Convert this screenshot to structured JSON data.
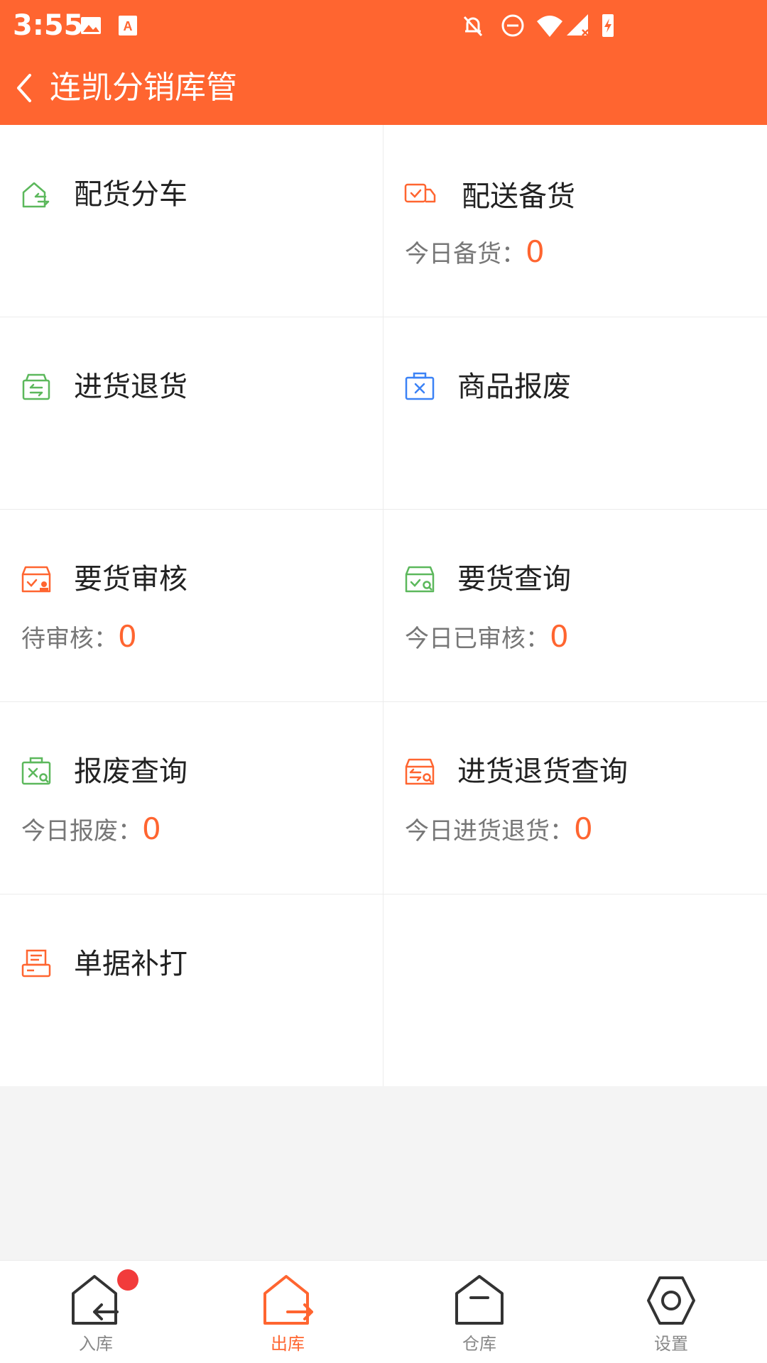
{
  "status": {
    "time": "3:55"
  },
  "header": {
    "title": "连凯分销库管"
  },
  "colors": {
    "brand": "#ff6530",
    "green": "#5cb85c",
    "blue": "#3b82f6",
    "badge": "#f23b3b"
  },
  "grid": [
    {
      "title": "配货分车",
      "icon": "truck-split-icon"
    },
    {
      "title": "配送备货",
      "icon": "delivery-truck-icon",
      "sub_label": "今日备货：",
      "sub_value": "0"
    },
    {
      "title": "进货退货",
      "icon": "return-box-icon"
    },
    {
      "title": "商品报废",
      "icon": "scrap-icon"
    },
    {
      "title": "要货审核",
      "icon": "order-review-icon",
      "sub_label": "待审核：",
      "sub_value": "0"
    },
    {
      "title": "要货查询",
      "icon": "order-search-icon",
      "sub_label": "今日已审核：",
      "sub_value": "0"
    },
    {
      "title": "报废查询",
      "icon": "scrap-search-icon",
      "sub_label": "今日报废：",
      "sub_value": "0"
    },
    {
      "title": "进货退货查询",
      "icon": "return-search-icon",
      "sub_label": "今日进货退货：",
      "sub_value": "0"
    },
    {
      "title": "单据补打",
      "icon": "printer-icon"
    }
  ],
  "nav": [
    {
      "label": "入库",
      "icon": "inbound-icon",
      "badge": true
    },
    {
      "label": "出库",
      "icon": "outbound-icon",
      "active": true
    },
    {
      "label": "仓库",
      "icon": "warehouse-icon"
    },
    {
      "label": "设置",
      "icon": "settings-icon"
    }
  ]
}
